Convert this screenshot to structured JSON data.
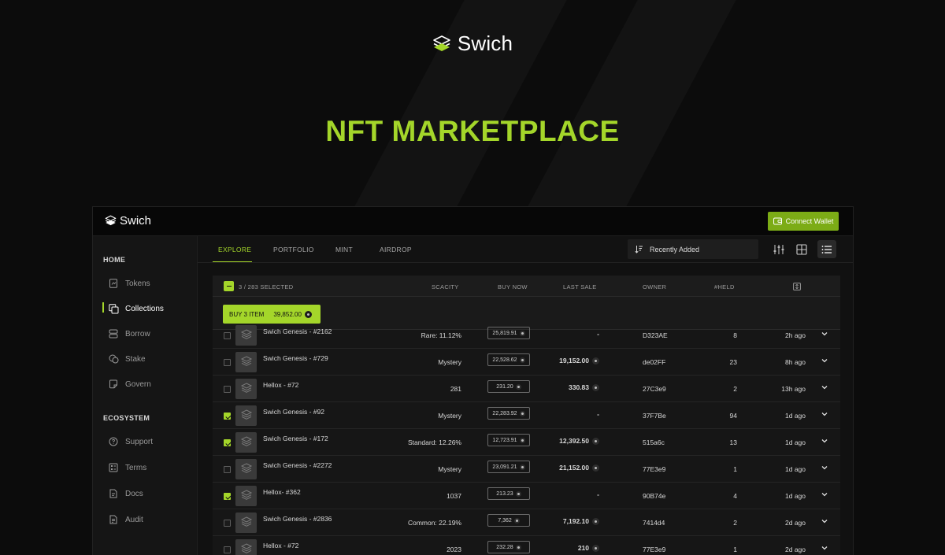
{
  "hero": {
    "brand": "Swich",
    "title": "NFT MARKETPLACE"
  },
  "app": {
    "brand": "Swich",
    "connect_wallet": "Connect Wallet"
  },
  "sidebar": {
    "home_heading": "HOME",
    "home_items": [
      {
        "label": "Tokens",
        "icon": "token-icon"
      },
      {
        "label": "Collections",
        "icon": "collections-icon",
        "active": true
      },
      {
        "label": "Borrow",
        "icon": "borrow-icon"
      },
      {
        "label": "Stake",
        "icon": "stake-icon"
      },
      {
        "label": "Govern",
        "icon": "govern-icon"
      }
    ],
    "ecosystem_heading": "ECOSYSTEM",
    "ecosystem_items": [
      {
        "label": "Support",
        "icon": "support-icon"
      },
      {
        "label": "Terms",
        "icon": "terms-icon"
      },
      {
        "label": "Docs",
        "icon": "docs-icon"
      },
      {
        "label": "Audit",
        "icon": "audit-icon"
      }
    ]
  },
  "tabs": [
    "EXPLORE",
    "PORTFOLIO",
    "MINT",
    "AIRDROP"
  ],
  "active_tab": "EXPLORE",
  "sort": {
    "selected": "Recently Added"
  },
  "table": {
    "selected_text": "3 / 283 SELECTED",
    "columns": [
      "SCACITY",
      "BUY NOW",
      "LAST SALE",
      "OWNER",
      "#HELD"
    ],
    "buy_button": {
      "label": "BUY 3 ITEM",
      "amount": "39,852.00"
    },
    "rows": [
      {
        "checked": false,
        "name": "Swich Genesis - #2162",
        "scarcity": "Rare: 11.12%",
        "buy_now": "25,819.91",
        "last_sale": "-",
        "owner": "D323AE",
        "held": "8",
        "ago": "2h ago"
      },
      {
        "checked": false,
        "name": "Swich Genesis - #729",
        "scarcity": "Mystery",
        "buy_now": "22,528.62",
        "last_sale": "19,152.00",
        "owner": "de02FF",
        "held": "23",
        "ago": "8h ago"
      },
      {
        "checked": false,
        "name": "Hellox - #72",
        "scarcity": "281",
        "buy_now": "231.20",
        "last_sale": "330.83",
        "owner": "27C3e9",
        "held": "2",
        "ago": "13h ago"
      },
      {
        "checked": true,
        "name": "Swich Genesis - #92",
        "scarcity": "Mystery",
        "buy_now": "22,283.92",
        "last_sale": "-",
        "owner": "37F7Be",
        "held": "94",
        "ago": "1d ago"
      },
      {
        "checked": true,
        "name": "Swich Genesis - #172",
        "scarcity": "Standard: 12.26%",
        "buy_now": "12,723.91",
        "last_sale": "12,392.50",
        "owner": "515a6c",
        "held": "13",
        "ago": "1d ago"
      },
      {
        "checked": false,
        "name": "Swich Genesis - #2272",
        "scarcity": "Mystery",
        "buy_now": "23,091.21",
        "last_sale": "21,152.00",
        "owner": "77E3e9",
        "held": "1",
        "ago": "1d ago"
      },
      {
        "checked": true,
        "name": "Hellox- #362",
        "scarcity": "1037",
        "buy_now": "213.23",
        "last_sale": "-",
        "owner": "90B74e",
        "held": "4",
        "ago": "1d ago"
      },
      {
        "checked": false,
        "name": "Swich Genesis - #2836",
        "scarcity": "Common: 22.19%",
        "buy_now": "7,362",
        "last_sale": "7,192.10",
        "owner": "7414d4",
        "held": "2",
        "ago": "2d ago"
      },
      {
        "checked": false,
        "name": "Hellox - #72",
        "scarcity": "2023",
        "buy_now": "232.28",
        "last_sale": "210",
        "owner": "77E3e9",
        "held": "1",
        "ago": "2d ago"
      }
    ]
  },
  "colors": {
    "accent": "#a4d62a",
    "connect": "#7cac16",
    "background": "#0c0c0c"
  }
}
